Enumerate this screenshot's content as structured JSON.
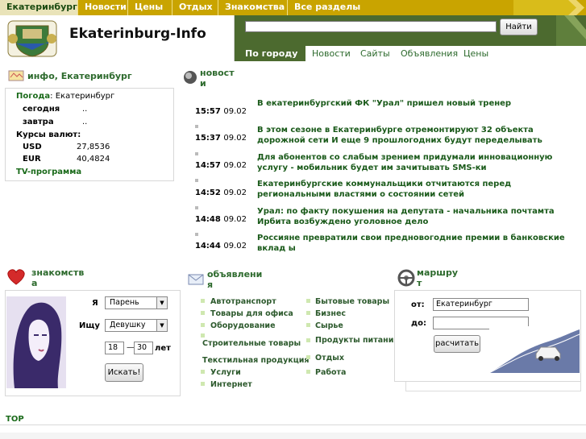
{
  "topnav": {
    "items": [
      "Екатеринбург",
      "Новости",
      "Цены",
      "Отдых",
      "Знакомства",
      "Все разделы"
    ]
  },
  "header": {
    "site_name": "Ekaterinburg-Info",
    "search_placeholder": "",
    "search_button": "Найти",
    "subtabs": [
      "По городу",
      "Новости",
      "Сайты",
      "Объявления",
      "Цены"
    ]
  },
  "info": {
    "title": "инфо, Екатеринбург",
    "weather_label": "Погода",
    "weather_city": ": Екатеринбург",
    "today_label": "сегодня",
    "today_value": "..",
    "tomorrow_label": "завтра",
    "tomorrow_value": "..",
    "rates_label": "Курсы валют:",
    "usd_label": "USD",
    "usd_value": "27,8536",
    "eur_label": "EUR",
    "eur_value": "40,4824",
    "tv_label": "TV-программа"
  },
  "news": {
    "title_a": "новост",
    "title_b": "и",
    "items": [
      {
        "time": "15:57",
        "date": "09.02",
        "text": "В екатеринбургский ФК \"Урал\" пришел новый тренер"
      },
      {
        "time": "15:37",
        "date": "09.02",
        "text": "В этом сезоне в Екатеринбурге отремонтируют 32 объекта дорожной сети И еще 9 прошлогодних будут переделывать"
      },
      {
        "time": "14:57",
        "date": "09.02",
        "text": "Для абонентов со слабым зрением придумали инновационную услугу - мобильник будет им зачитывать SMS-ки"
      },
      {
        "time": "14:52",
        "date": "09.02",
        "text": "Екатеринбургские коммунальщики отчитаются перед региональными властями о состоянии сетей"
      },
      {
        "time": "14:48",
        "date": "09.02",
        "text": "Урал: по факту покушения на депутата - начальника почтамта Ирбита возбуждено уголовное дело"
      },
      {
        "time": "14:44",
        "date": "09.02",
        "text": "Россияне превратили свои предновогодние премии в банковские вклад ы"
      }
    ]
  },
  "dating": {
    "title_a": "знакомств",
    "title_b": "а",
    "i_label": "Я",
    "i_value": "Парень",
    "seek_label": "Ищу",
    "seek_value": "Девушку",
    "age_from": "18",
    "age_dash": "—",
    "age_to": "30",
    "age_unit": "лет",
    "search_button": "Искать!"
  },
  "ads": {
    "title_a": "объявлени",
    "title_b": "я",
    "col1": [
      "Автотранспорт",
      "Товары для офиса",
      "Оборудование",
      "Строительные товары",
      "Текстильная продукция",
      "Услуги",
      "Интернет"
    ],
    "col2": [
      "Бытовые товары",
      "Бизнес",
      "Сырье",
      "Продукты питания",
      "Отдых",
      "Работа"
    ]
  },
  "route": {
    "title_a": "маршру",
    "title_b": "т",
    "from_label": "от:",
    "from_value": "Екатеринбург",
    "to_label": "до:",
    "to_value": "",
    "calc_button": "расчитать"
  },
  "footer": {
    "top_label": "TOP"
  },
  "colors": {
    "nav_gold": "#c9a400",
    "header_green": "#4c6a2f",
    "link_green": "#2d6a2d"
  }
}
